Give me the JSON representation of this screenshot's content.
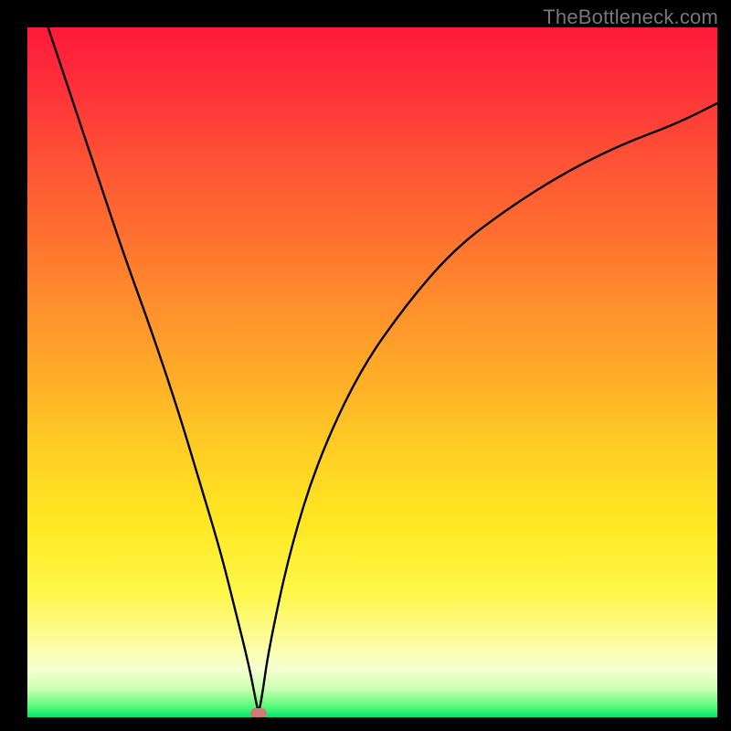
{
  "watermark": "TheBottleneck.com",
  "chart_data": {
    "type": "line",
    "title": "",
    "xlabel": "",
    "ylabel": "",
    "xlim": [
      0,
      100
    ],
    "ylim": [
      0,
      100
    ],
    "grid": false,
    "legend": false,
    "series": [
      {
        "name": "curve",
        "x": [
          3,
          6,
          10,
          14,
          18,
          22,
          25,
          28,
          30,
          32,
          33,
          33.5,
          34,
          35,
          38,
          42,
          48,
          55,
          62,
          70,
          78,
          86,
          94,
          100
        ],
        "y": [
          100,
          91,
          79,
          67,
          56,
          44,
          34,
          24,
          16,
          8,
          3,
          0.5,
          3,
          10,
          24,
          37,
          50,
          60,
          68,
          74,
          79,
          83,
          86,
          89
        ]
      }
    ],
    "min_point": {
      "x": 33.5,
      "y": 0.5
    },
    "colors": {
      "curve": "#000000",
      "min_marker": "#cf7a76",
      "gradient_top": "#ff1a3a",
      "gradient_bottom": "#00e56a",
      "background": "#000000"
    }
  }
}
